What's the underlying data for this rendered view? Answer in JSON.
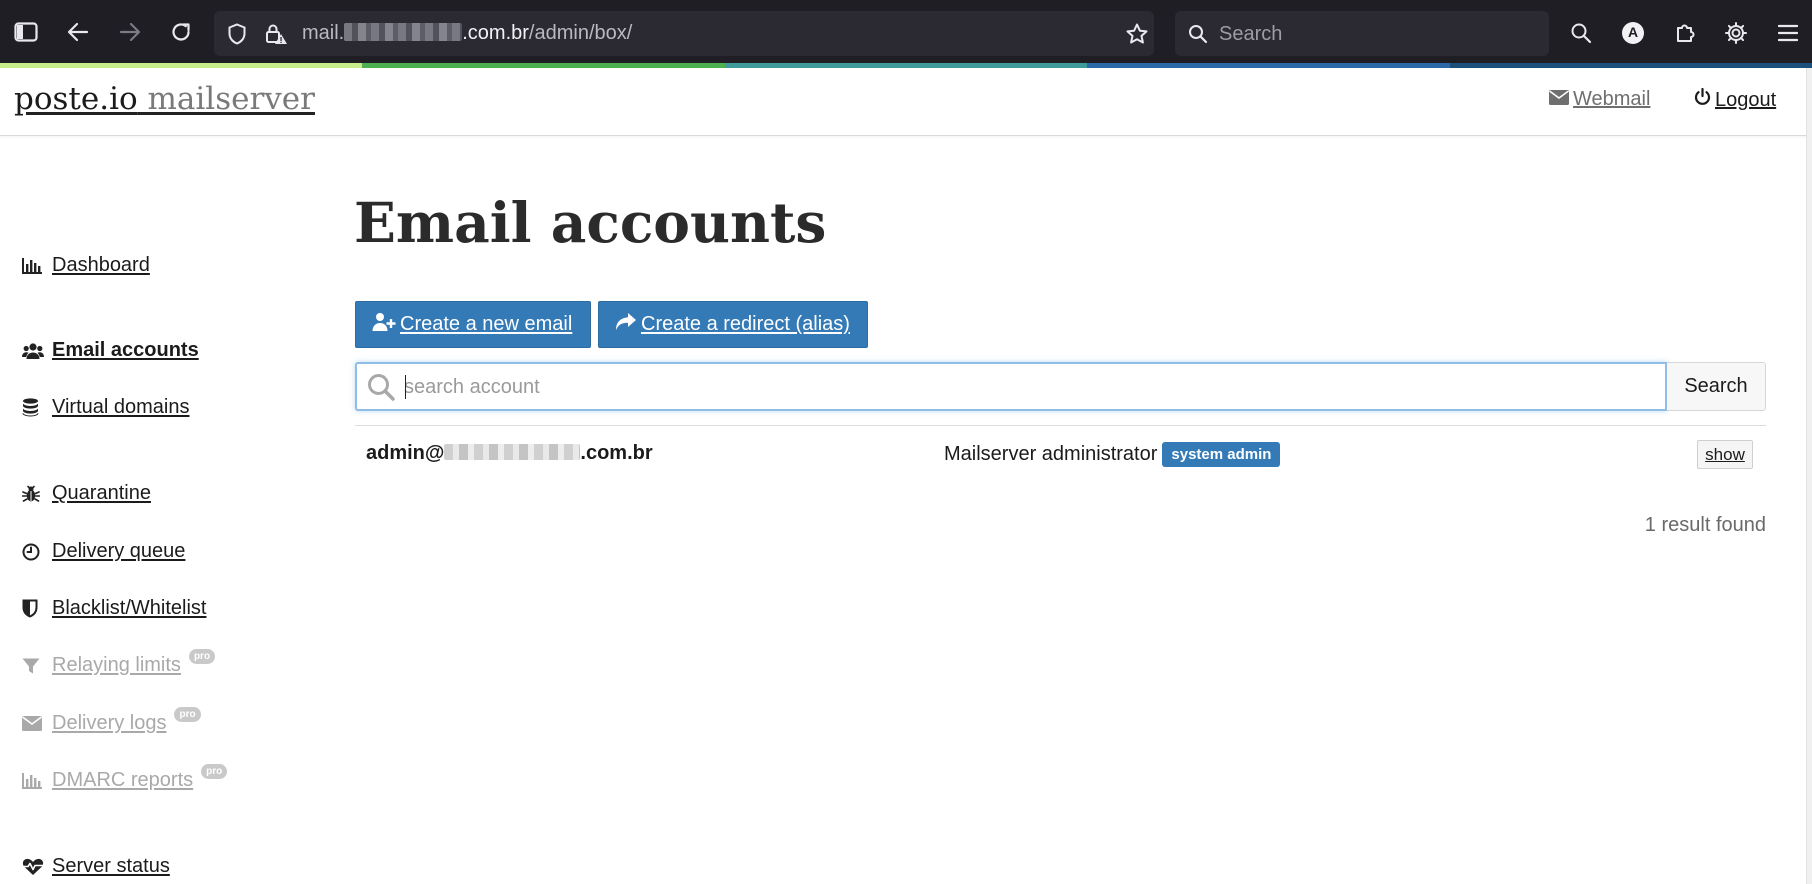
{
  "browser": {
    "url_host_prefix": "mail.",
    "url_host_suffix": ".com.br",
    "url_path": "/admin/box/",
    "search_placeholder": "Search",
    "profile_initial": "A",
    "accent_colors": [
      "#c7ec8a",
      "#4caf50",
      "#3f9a9c",
      "#2b6aa8",
      "#1c4f7a"
    ]
  },
  "header": {
    "brand_primary": "poste.io",
    "brand_secondary": "mailserver",
    "webmail_label": "Webmail",
    "logout_label": "Logout"
  },
  "sidebar": {
    "items": [
      {
        "label": "Dashboard",
        "icon": "bar-chart-icon",
        "active": false,
        "disabled": false,
        "pro": false
      },
      {
        "label": "Email accounts",
        "icon": "users-icon",
        "active": true,
        "disabled": false,
        "pro": false
      },
      {
        "label": "Virtual domains",
        "icon": "database-icon",
        "active": false,
        "disabled": false,
        "pro": false
      },
      {
        "label": "Quarantine",
        "icon": "bug-icon",
        "active": false,
        "disabled": false,
        "pro": false
      },
      {
        "label": "Delivery queue",
        "icon": "clock-icon",
        "active": false,
        "disabled": false,
        "pro": false
      },
      {
        "label": "Blacklist/Whitelist",
        "icon": "shield-icon",
        "active": false,
        "disabled": false,
        "pro": false
      },
      {
        "label": "Relaying limits",
        "icon": "filter-icon",
        "active": false,
        "disabled": true,
        "pro": true
      },
      {
        "label": "Delivery logs",
        "icon": "envelope-icon",
        "active": false,
        "disabled": true,
        "pro": true
      },
      {
        "label": "DMARC reports",
        "icon": "bar-chart-icon",
        "active": false,
        "disabled": true,
        "pro": true
      },
      {
        "label": "Server status",
        "icon": "heartbeat-icon",
        "active": false,
        "disabled": false,
        "pro": false
      }
    ],
    "pro_label": "pro"
  },
  "main": {
    "title": "Email accounts",
    "create_email_label": "Create a new email",
    "create_redirect_label": "Create a redirect (alias)",
    "search_placeholder": "search account",
    "search_button_label": "Search",
    "accounts": [
      {
        "email_prefix": "admin@",
        "email_suffix": ".com.br",
        "name": "Mailserver administrator",
        "badge": "system admin",
        "action_label": "show"
      }
    ],
    "result_count": "1 result found"
  }
}
